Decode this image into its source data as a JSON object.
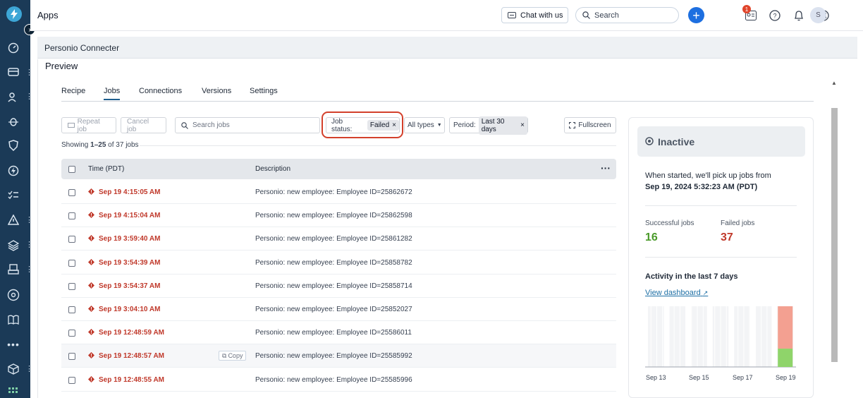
{
  "header": {
    "apps_label": "Apps",
    "chat_label": "Chat with us",
    "search_placeholder": "Search",
    "notification_count": "1",
    "avatar_initial": "S"
  },
  "project": {
    "title": "Personio Connecter",
    "preview_label": "Preview"
  },
  "tabs": [
    {
      "label": "Recipe"
    },
    {
      "label": "Jobs"
    },
    {
      "label": "Connections"
    },
    {
      "label": "Versions"
    },
    {
      "label": "Settings"
    }
  ],
  "filters": {
    "repeat_job": "Repeat job",
    "cancel_job": "Cancel job",
    "search_placeholder": "Search jobs",
    "job_status_label": "Job status:",
    "job_status_value": "Failed",
    "types_label": "All types",
    "period_label": "Period:",
    "period_value": "Last 30 days",
    "fullscreen_label": "Fullscreen"
  },
  "showing": {
    "prefix": "Showing ",
    "range": "1–25",
    "suffix": " of 37 jobs"
  },
  "table": {
    "col_time": "Time (PDT)",
    "col_description": "Description",
    "copy_label": "Copy",
    "rows": [
      {
        "time": "Sep 19 4:15:05 AM",
        "description": "Personio: new employee: Employee ID=25862672"
      },
      {
        "time": "Sep 19 4:15:04 AM",
        "description": "Personio: new employee: Employee ID=25862598"
      },
      {
        "time": "Sep 19 3:59:40 AM",
        "description": "Personio: new employee: Employee ID=25861282"
      },
      {
        "time": "Sep 19 3:54:39 AM",
        "description": "Personio: new employee: Employee ID=25858782"
      },
      {
        "time": "Sep 19 3:54:37 AM",
        "description": "Personio: new employee: Employee ID=25858714"
      },
      {
        "time": "Sep 19 3:04:10 AM",
        "description": "Personio: new employee: Employee ID=25852027"
      },
      {
        "time": "Sep 19 12:48:59 AM",
        "description": "Personio: new employee: Employee ID=25586011"
      },
      {
        "time": "Sep 19 12:48:57 AM",
        "description": "Personio: new employee: Employee ID=25585992"
      },
      {
        "time": "Sep 19 12:48:55 AM",
        "description": "Personio: new employee: Employee ID=25585996"
      }
    ]
  },
  "panel": {
    "status": "Inactive",
    "started_text": "When started, we'll pick up jobs from",
    "started_date": "Sep 19, 2024 5:32:23 AM (PDT)",
    "successful_label": "Successful jobs",
    "successful_value": "16",
    "failed_label": "Failed jobs",
    "failed_value": "37",
    "activity_title": "Activity in the last 7 days",
    "dashboard_link": "View dashboard",
    "colors": {
      "success": "#4a9a2a",
      "failed": "#c0392b",
      "bar_success": "#8fd46a",
      "bar_failed": "#f3a091"
    }
  },
  "chart_data": {
    "type": "bar",
    "stacked": true,
    "x_tick_labels": [
      "Sep 13",
      "Sep 15",
      "Sep 17",
      "Sep 19"
    ],
    "categories": [
      "Sep 13",
      "Sep 14",
      "Sep 15",
      "Sep 16",
      "Sep 17",
      "Sep 18",
      "Sep 19"
    ],
    "series": [
      {
        "values": [
          0,
          0,
          0,
          0,
          0,
          0,
          16
        ],
        "color": "#8fd46a"
      },
      {
        "values": [
          0,
          0,
          0,
          0,
          0,
          0,
          37
        ],
        "color": "#f3a091"
      }
    ],
    "ylim": [
      0,
      53
    ],
    "grid": true
  }
}
